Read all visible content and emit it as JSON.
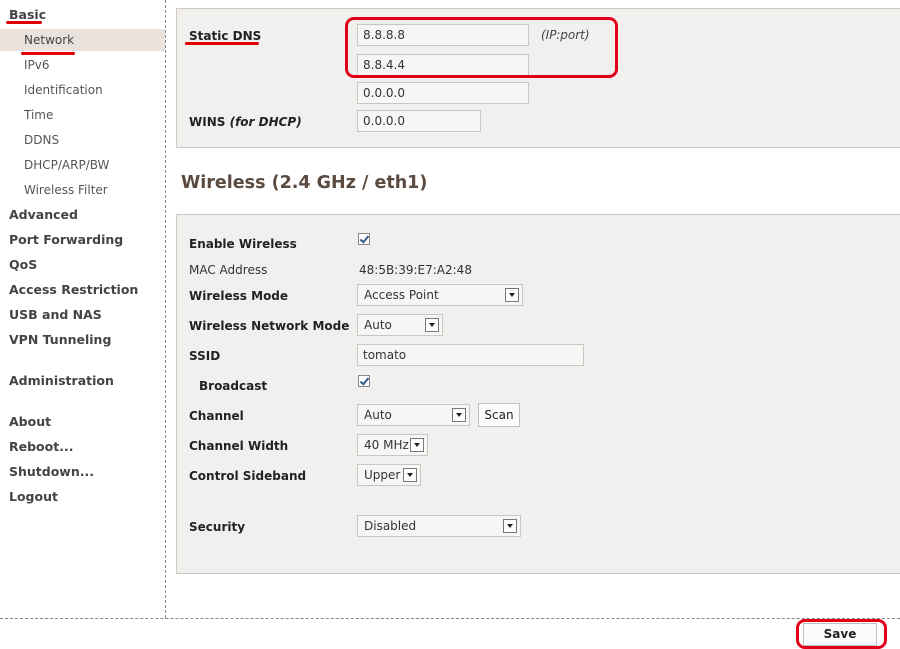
{
  "sidebar": {
    "items": [
      {
        "label": "Basic",
        "level": "top"
      },
      {
        "label": "Network",
        "level": "sub",
        "active": true
      },
      {
        "label": "IPv6",
        "level": "sub"
      },
      {
        "label": "Identification",
        "level": "sub"
      },
      {
        "label": "Time",
        "level": "sub"
      },
      {
        "label": "DDNS",
        "level": "sub"
      },
      {
        "label": "DHCP/ARP/BW",
        "level": "sub"
      },
      {
        "label": "Wireless Filter",
        "level": "sub"
      },
      {
        "label": "Advanced",
        "level": "top"
      },
      {
        "label": "Port Forwarding",
        "level": "top"
      },
      {
        "label": "QoS",
        "level": "top"
      },
      {
        "label": "Access Restriction",
        "level": "top"
      },
      {
        "label": "USB and NAS",
        "level": "top"
      },
      {
        "label": "VPN Tunneling",
        "level": "top"
      },
      {
        "label": "Administration",
        "level": "top"
      },
      {
        "label": "About",
        "level": "top"
      },
      {
        "label": "Reboot...",
        "level": "top"
      },
      {
        "label": "Shutdown...",
        "level": "top"
      },
      {
        "label": "Logout",
        "level": "top"
      }
    ]
  },
  "dns": {
    "static_dns_label": "Static DNS",
    "dns1": "8.8.8.8",
    "dns2": "8.8.4.4",
    "dns3": "0.0.0.0",
    "hint": "(IP:port)",
    "wins_label": "WINS",
    "wins_suffix": "(for DHCP)",
    "wins_value": "0.0.0.0"
  },
  "wireless": {
    "heading": "Wireless (2.4 GHz / eth1)",
    "enable_label": "Enable Wireless",
    "enable_checked": true,
    "mac_label": "MAC Address",
    "mac_value": "48:5B:39:E7:A2:48",
    "mode_label": "Wireless Mode",
    "mode_value": "Access Point",
    "netmode_label": "Wireless Network Mode",
    "netmode_value": "Auto",
    "ssid_label": "SSID",
    "ssid_value": "tomato",
    "broadcast_label": "Broadcast",
    "broadcast_checked": true,
    "channel_label": "Channel",
    "channel_value": "Auto",
    "scan_label": "Scan",
    "width_label": "Channel Width",
    "width_value": "40 MHz",
    "sideband_label": "Control Sideband",
    "sideband_value": "Upper",
    "security_label": "Security",
    "security_value": "Disabled"
  },
  "footer": {
    "save_label": "Save"
  },
  "colors": {
    "highlight": "#e0001a",
    "panel": "#f2f0ee",
    "active_nav": "#eae2dc"
  }
}
